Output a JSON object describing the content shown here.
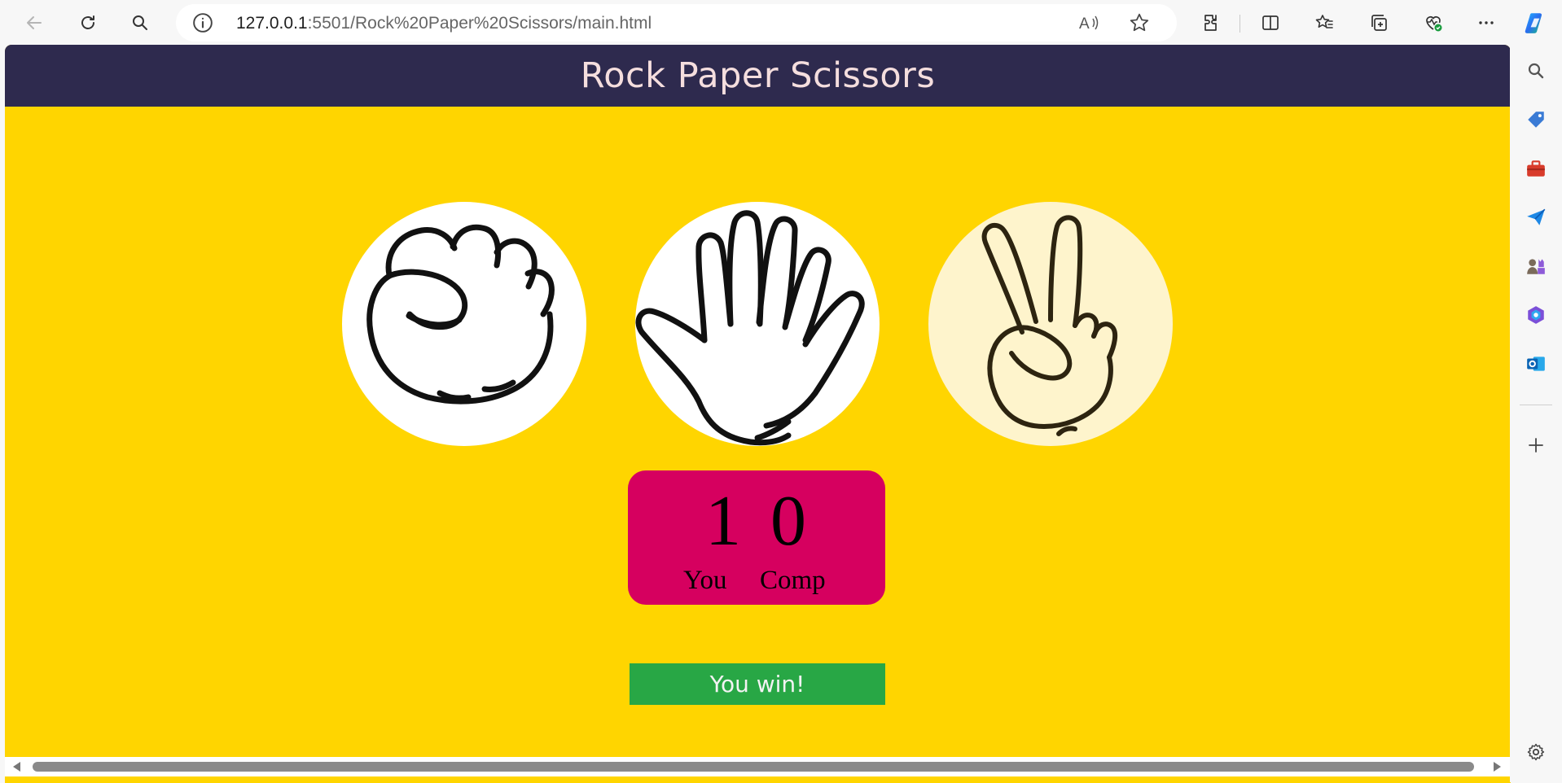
{
  "browser": {
    "url_host": "127.0.0.1",
    "url_rest": ":5501/Rock%20Paper%20Scissors/main.html",
    "read_aloud_label": "A̅)",
    "icons": [
      "back-icon",
      "refresh-icon",
      "search-icon",
      "site-info-icon",
      "read-aloud-icon",
      "favorite-star-icon",
      "extensions-icon",
      "split-screen-icon",
      "favorites-icon",
      "collections-icon",
      "browser-essentials-icon",
      "more-icon",
      "copilot-icon"
    ]
  },
  "sidebar": {
    "icons": [
      "search-icon",
      "shopping-tag-icon",
      "tools-icon",
      "send-icon",
      "games-icon",
      "microsoft365-icon",
      "outlook-icon",
      "add-icon",
      "settings-icon"
    ]
  },
  "page": {
    "title": "Rock Paper Scissors",
    "choices": [
      {
        "name": "rock",
        "icon": "rock-fist-icon",
        "selected": false
      },
      {
        "name": "paper",
        "icon": "paper-hand-icon",
        "selected": false
      },
      {
        "name": "scissors",
        "icon": "scissors-hand-icon",
        "selected": true
      }
    ],
    "score": {
      "user_score": "1",
      "comp_score": "0",
      "user_label": "You",
      "comp_label": "Comp"
    },
    "result_message": "You win!"
  },
  "colors": {
    "page_background": "#ffd500",
    "header_background": "#2e2a4e",
    "header_text": "#f5dede",
    "scoreboard_background": "#d6005f",
    "result_background": "#28a745",
    "selected_choice_background": "#fef4cc"
  }
}
